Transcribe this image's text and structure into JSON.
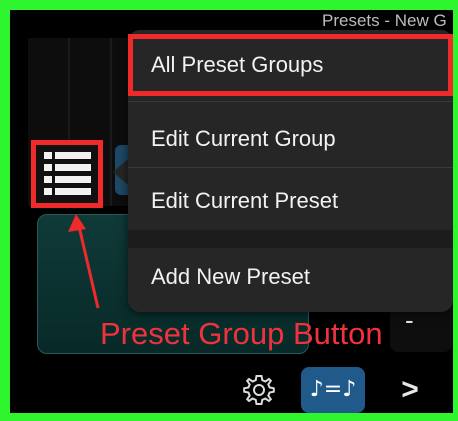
{
  "header": {
    "title": "Presets - New G"
  },
  "menu": {
    "items": [
      {
        "label": "All Preset Groups",
        "highlighted": true
      },
      {
        "label": "Edit Current Group",
        "highlighted": false
      },
      {
        "label": "Edit Current Preset",
        "highlighted": false
      },
      {
        "label": "Add New Preset",
        "highlighted": false
      }
    ]
  },
  "annotation": {
    "callout_label": "Preset Group Button",
    "color": "#ee2a2a"
  },
  "toolbar": {
    "gear_icon": "gear-icon",
    "tempo_label": "♪=♪",
    "next_label": ">"
  },
  "colors": {
    "frame": "#2ef52e",
    "accent_teal": "#0f3a38",
    "accent_blue": "#1f5a8a",
    "menu_bg": "#262626"
  },
  "minus_label": "-"
}
